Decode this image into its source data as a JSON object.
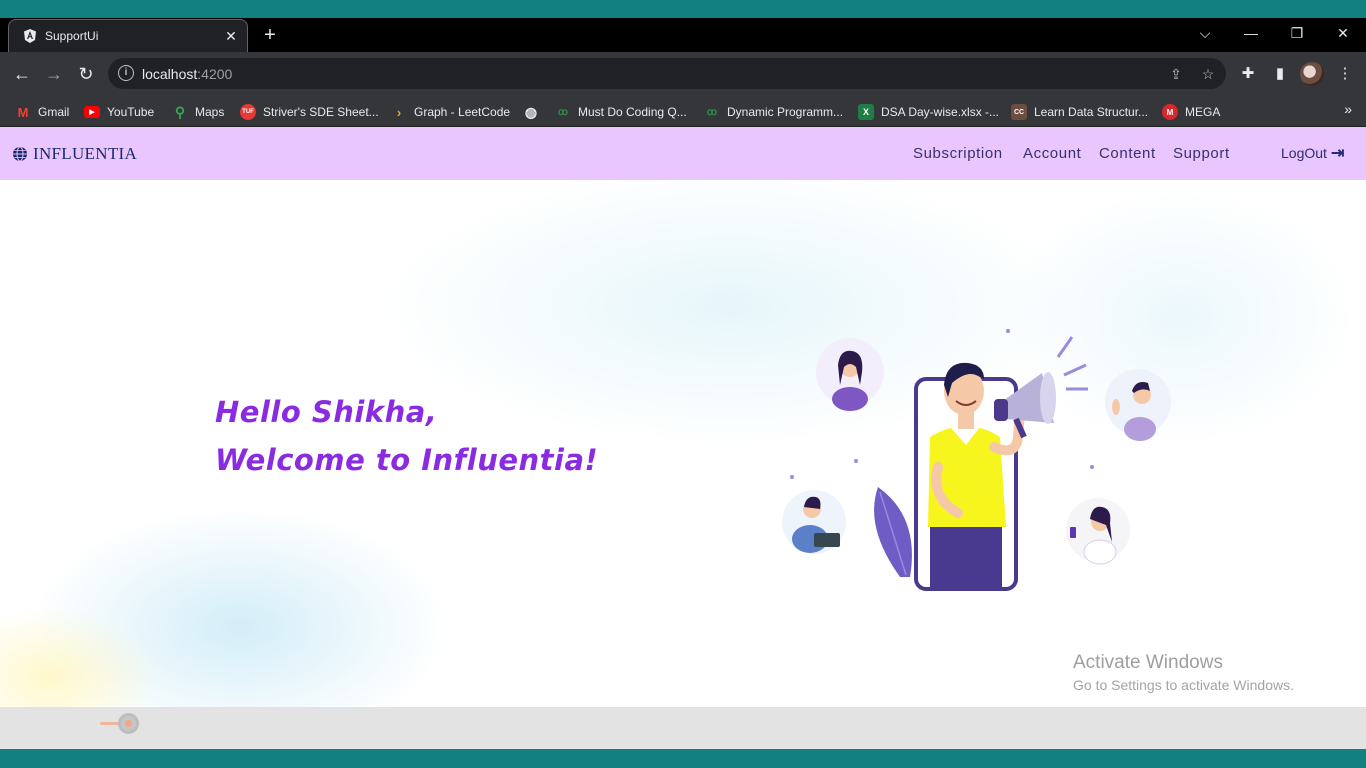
{
  "browser": {
    "tab_title": "SupportUi",
    "tab_close": "✕",
    "new_tab": "+",
    "window_controls": {
      "dropdown": "⌵",
      "minimize": "—",
      "restore": "❐",
      "close": "✕"
    },
    "nav": {
      "back": "←",
      "forward": "→",
      "reload": "↻"
    },
    "url_host": "localhost",
    "url_port": ":4200",
    "bookmarks": [
      {
        "label": "Gmail",
        "icon": "gmail-icon"
      },
      {
        "label": "YouTube",
        "icon": "youtube-icon"
      },
      {
        "label": "Maps",
        "icon": "maps-icon"
      },
      {
        "label": "Striver's SDE Sheet...",
        "icon": "tuf-icon"
      },
      {
        "label": "Graph - LeetCode",
        "icon": "leetcode-icon"
      },
      {
        "label": "",
        "icon": "globe-icon"
      },
      {
        "label": "Must Do Coding Q...",
        "icon": "gfg-icon"
      },
      {
        "label": "Dynamic Programm...",
        "icon": "gfg-icon"
      },
      {
        "label": "DSA Day-wise.xlsx -...",
        "icon": "excel-icon"
      },
      {
        "label": "Learn Data Structur...",
        "icon": "cc-icon"
      },
      {
        "label": "MEGA",
        "icon": "mega-icon"
      }
    ],
    "bookmarks_more": "»"
  },
  "app": {
    "brand": "INFLUENTIA",
    "nav_links": [
      "Subscription",
      "Account",
      "Content",
      "Support"
    ],
    "logout": "LogOut"
  },
  "hero": {
    "line1": "Hello Shikha,",
    "line2": "Welcome to Influentia!"
  },
  "watermark": {
    "title": "Activate Windows",
    "subtitle": "Go to Settings to activate Windows."
  },
  "colors": {
    "navbar_bg": "#e9c6fd",
    "greeting": "#8a2be2",
    "chrome_dark": "#35363a",
    "taskbar_teal": "#127f80"
  }
}
